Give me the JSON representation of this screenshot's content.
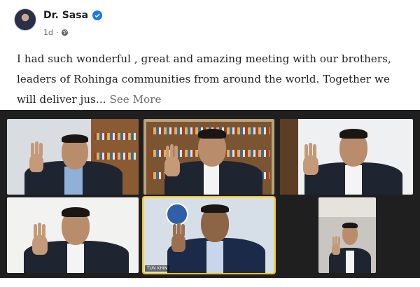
{
  "post": {
    "author": "Dr. Sasa",
    "time": "1d",
    "text": "I had such wonderful , great and amazing meeting with our brothers, leaders of Rohinga communities from around the world. Together we will deliver jus...",
    "see_more": "See More"
  },
  "video_call": {
    "participants": [
      {
        "tile": 1
      },
      {
        "tile": 2
      },
      {
        "tile": 3
      },
      {
        "tile": 4
      },
      {
        "tile": 5,
        "name_tag": "TUN KHIN",
        "active_speaker": true
      },
      {
        "tile": 6
      }
    ],
    "active_speaker_color": "#f5c400"
  },
  "colors": {
    "verified": "#1877f2",
    "meta": "#65676b",
    "text": "#1c1e21"
  }
}
